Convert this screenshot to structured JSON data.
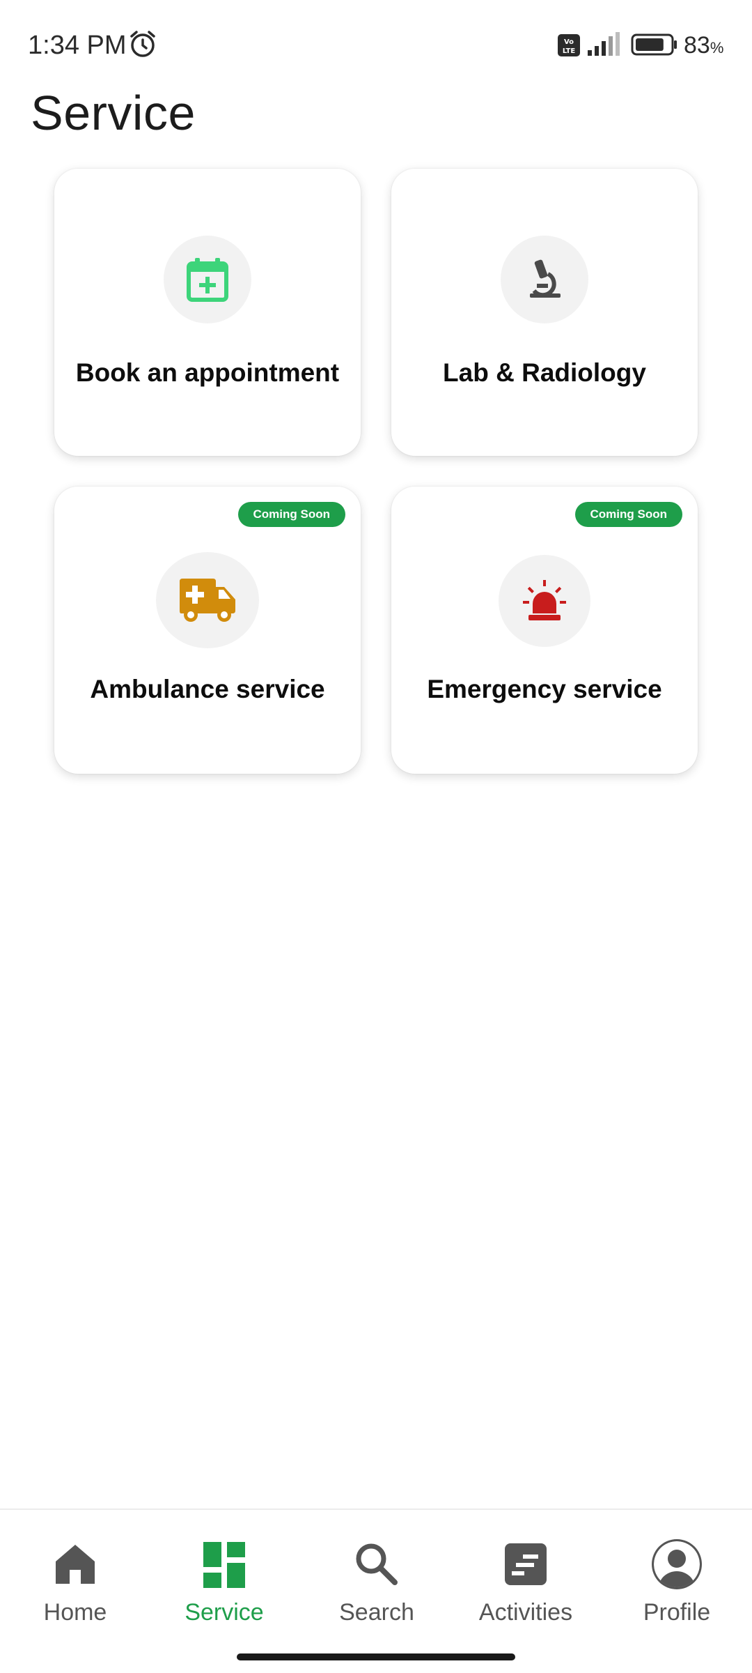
{
  "status_bar": {
    "time": "1:34 PM",
    "battery_percent": "83",
    "battery_pct_sign": "%",
    "battery_level": 0.83,
    "icons": [
      "alarm-icon",
      "volte-icon",
      "signal-icon",
      "battery-icon"
    ]
  },
  "page": {
    "title": "Service"
  },
  "services": [
    {
      "label": "Book an appointment",
      "icon": "calendar-plus-icon",
      "icon_color": "#3dd47a",
      "badge": ""
    },
    {
      "label": "Lab & Radiology",
      "icon": "microscope-icon",
      "icon_color": "#4a4a4a",
      "badge": ""
    },
    {
      "label": "Ambulance service",
      "icon": "ambulance-icon",
      "icon_color": "#d18c0c",
      "badge": "Coming Soon"
    },
    {
      "label": "Emergency service",
      "icon": "siren-icon",
      "icon_color": "#c81d1d",
      "badge": "Coming Soon"
    }
  ],
  "bottom_nav": {
    "items": [
      {
        "label": "Home",
        "icon": "home-icon",
        "active": false
      },
      {
        "label": "Service",
        "icon": "dashboard-icon",
        "active": true
      },
      {
        "label": "Search",
        "icon": "search-icon",
        "active": false
      },
      {
        "label": "Activities",
        "icon": "activities-icon",
        "active": false
      },
      {
        "label": "Profile",
        "icon": "profile-icon",
        "active": false
      }
    ]
  },
  "colors": {
    "accent": "#1e9e4a",
    "nav_inactive": "#555555",
    "icon_circle_bg": "#f2f2f2"
  }
}
